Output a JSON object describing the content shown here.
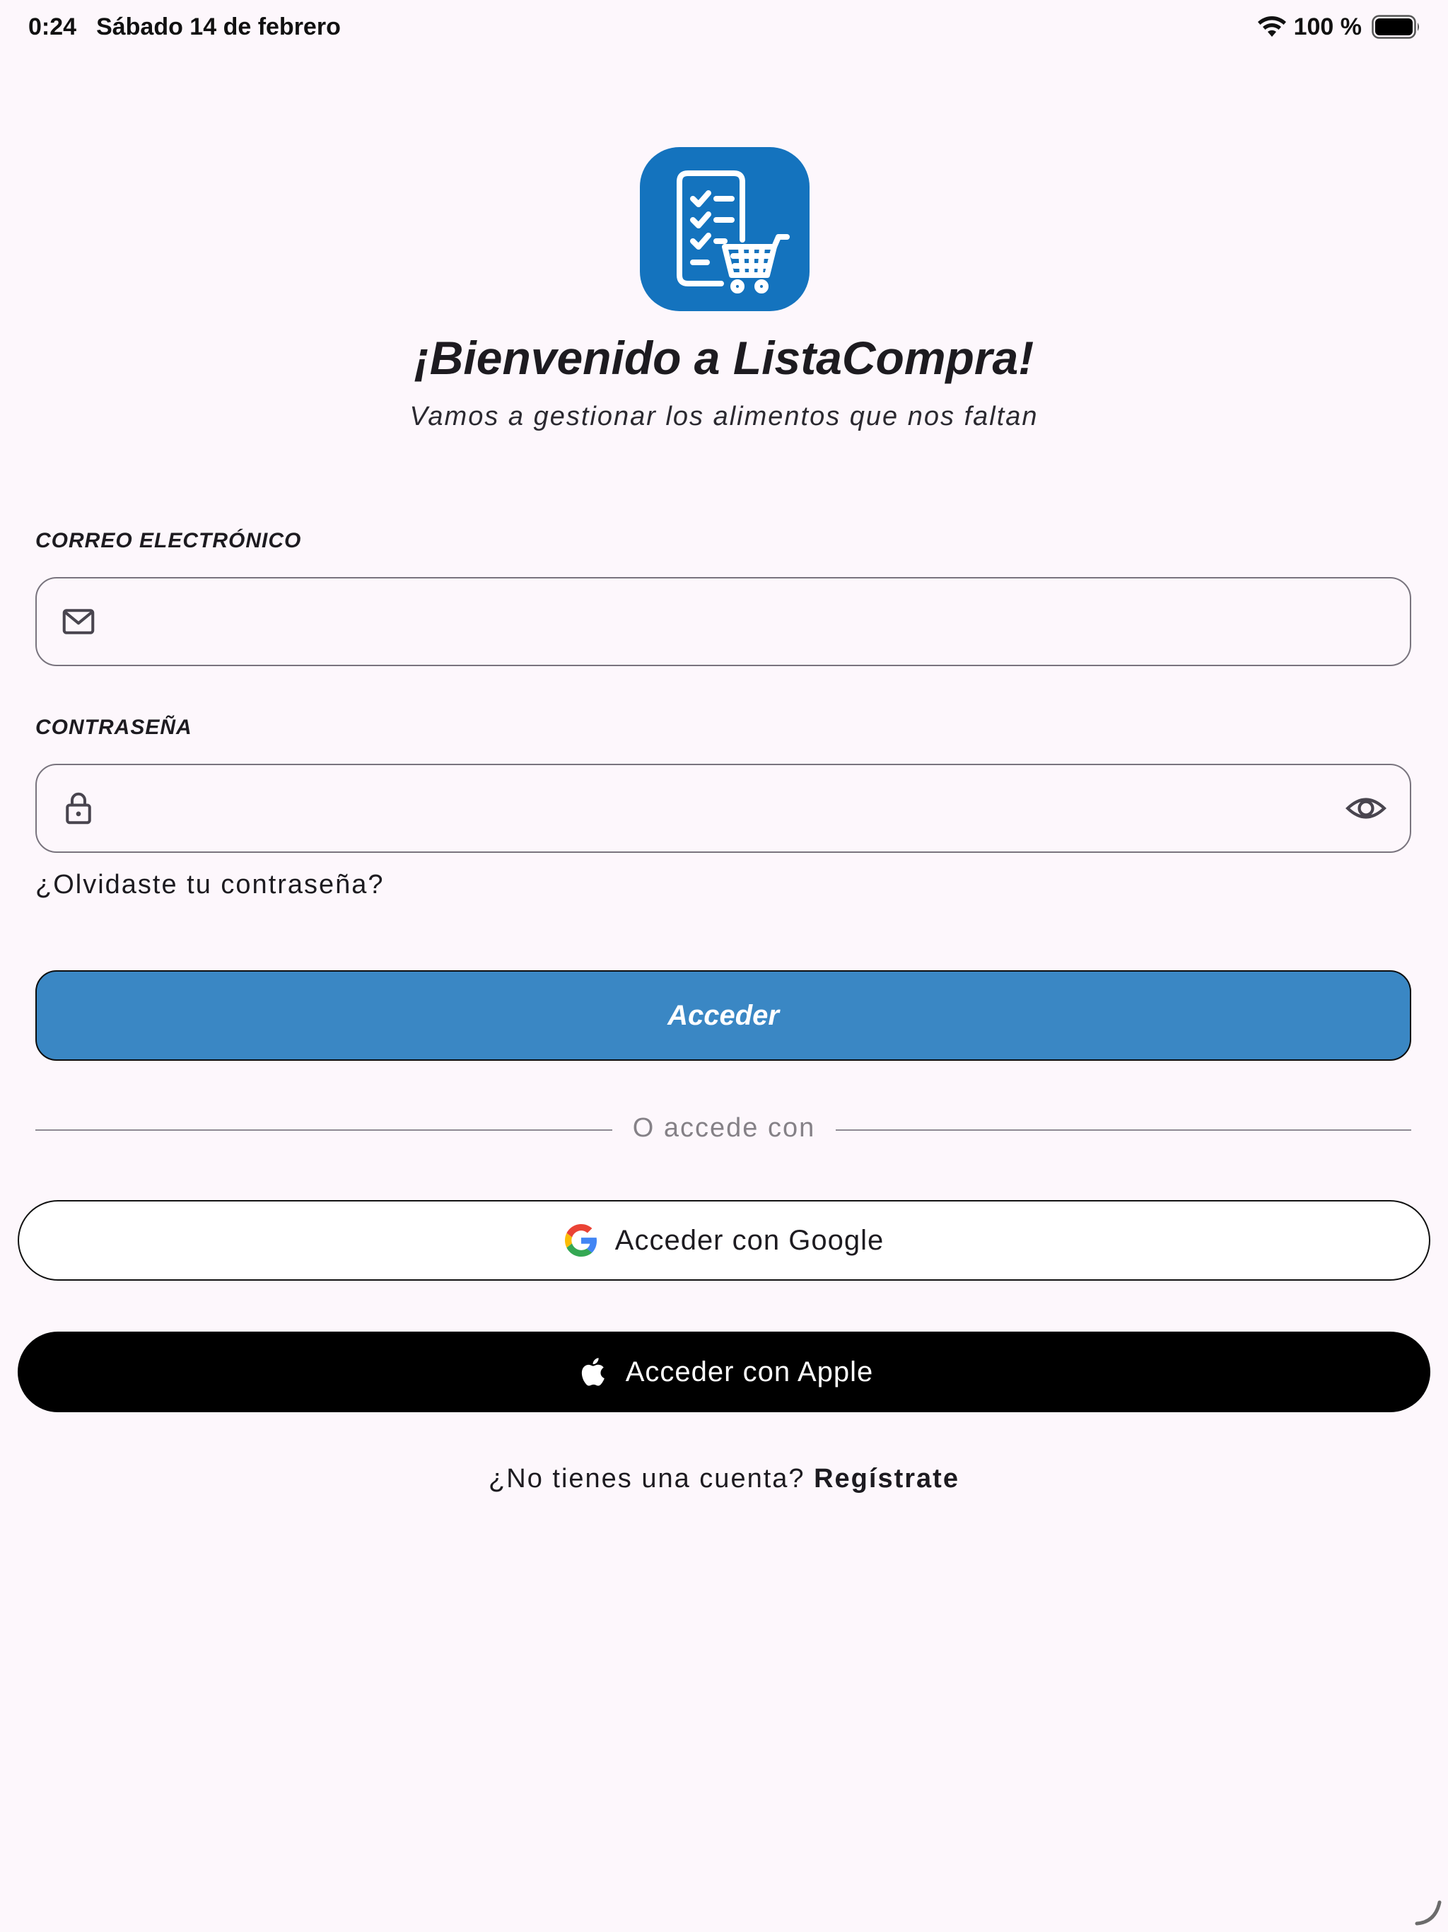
{
  "status_bar": {
    "time": "0:24",
    "date": "Sábado 14 de febrero",
    "battery": "100 %"
  },
  "logo": {
    "icon": "shopping-list-cart-icon",
    "color": "#1473be"
  },
  "welcome": {
    "title": "¡Bienvenido a ListaCompra!",
    "subtitle": "Vamos a gestionar los alimentos que nos faltan"
  },
  "form": {
    "email": {
      "label": "CORREO ELECTRÓNICO",
      "value": "",
      "placeholder": "",
      "icon": "mail-icon"
    },
    "password": {
      "label": "CONTRASEÑA",
      "value": "",
      "placeholder": "",
      "icon": "lock-icon",
      "toggle_icon": "eye-icon"
    },
    "forgot": "¿Olvidaste tu contraseña?",
    "submit": "Acceder"
  },
  "divider": "O accede con",
  "social": {
    "google": "Acceder con Google",
    "apple": "Acceder con Apple"
  },
  "signup": {
    "prompt": "¿No tienes una cuenta?",
    "link": "Regístrate"
  },
  "colors": {
    "background": "#fdf7fc",
    "primary": "#3a87c4",
    "logo": "#1473be"
  }
}
